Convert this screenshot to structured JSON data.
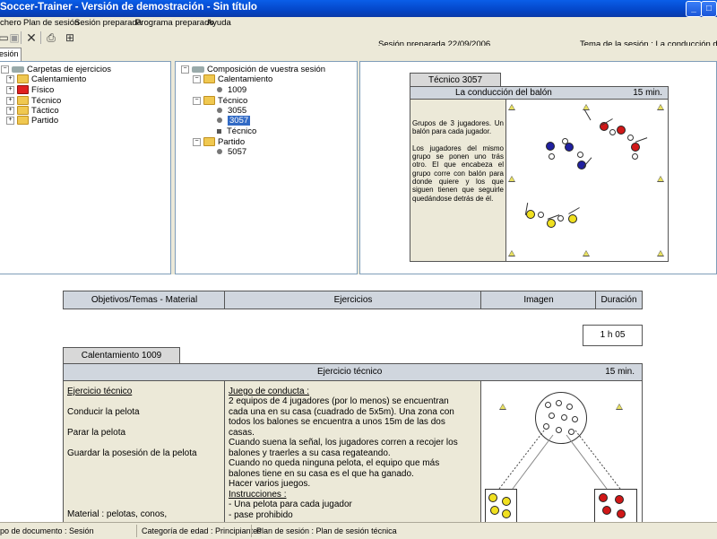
{
  "window": {
    "title": "Soccer-Trainer - Versión de demostración - Sin título"
  },
  "menu": [
    "chero",
    "Plan de sesión",
    "Sesión preparada",
    "Programa preparado",
    "Ayuda"
  ],
  "header": {
    "tab": "esión",
    "session_date": "Sesión preparada 22/09/2006",
    "session_theme": "Tema de la sesión : La conducción del bal"
  },
  "left_tree": {
    "root": "Carpetas de ejercicios",
    "items": [
      "Calentamiento",
      "Físico",
      "Técnico",
      "Táctico",
      "Partido"
    ]
  },
  "middle_tree": {
    "root": "Composición de vuestra sesión",
    "groups": [
      {
        "label": "Calentamiento",
        "children": [
          "1009"
        ]
      },
      {
        "label": "Técnico",
        "children": [
          "3055",
          "3057",
          "Técnico"
        ]
      },
      {
        "label": "Partido",
        "children": [
          "5057"
        ]
      }
    ]
  },
  "preview_card": {
    "tab": "Técnico 3057",
    "title": "La conducción del balón",
    "duration": "15 min.",
    "text": "Grupos de 3 jugadores. Un balón para cada jugador.\n\nLos jugadores del mismo grupo se ponen uno trás otro. El que encabeza el grupo corre con balón para donde quiere y los que siguen tienen que seguirle quedándose detrás de él."
  },
  "table_headers": [
    "Objetivos/Temas - Material",
    "Ejercicios",
    "Imagen",
    "Duración"
  ],
  "total_duration": "1 h 05",
  "exercise_card": {
    "tab": "Calentamiento 1009",
    "title": "Ejercicio técnico",
    "duration": "15 min.",
    "objectives_title": "Ejercicio técnico",
    "objectives": [
      "Conducir la pelota",
      "Parar la pelota",
      "Guardar la posesión de la pelota"
    ],
    "material": "Material : pelotas, conos,",
    "rules_title": "Juego de conducta :",
    "rules_lines": [
      "2 equipos de 4 jugadores (por lo menos) se encuentran",
      "cada una en su casa (cuadrado de 5x5m). Una zona con",
      "todos los balones se encuentra a unos 15m de las dos",
      "casas.",
      "Cuando suena la señal, los jugadores corren a recojer los",
      "balones y traerles a su casa regateando.",
      "Cuando no queda ninguna pelota, el equipo que más",
      "balones tiene en su casa es el que ha ganado.",
      "Hacer varios juegos."
    ],
    "instructions_title": "Instrucciones :",
    "instructions": [
      "- Una pelota para cada jugador",
      "- pase prohibido"
    ]
  },
  "status": {
    "doc_type": "po de documento : Sesión",
    "age": "Categoría de edad : Principiantes",
    "plan": "Plan de sesión : Plan de sesión técnica"
  },
  "colors": {
    "titlebar": "#0a5ee8",
    "selection": "#316ac5",
    "blue_team": "#2020a0",
    "red_team": "#d01818",
    "yellow_team": "#f0e020"
  }
}
